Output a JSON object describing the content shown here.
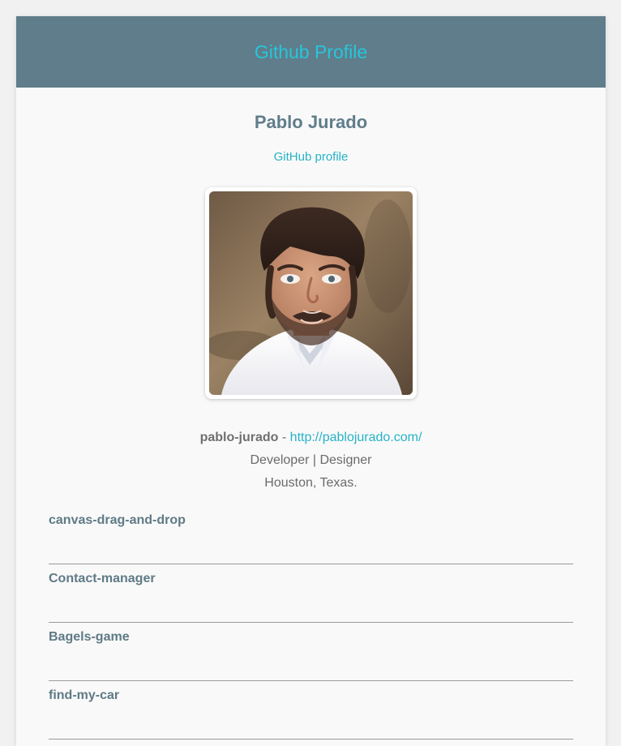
{
  "header": {
    "title": "Github Profile"
  },
  "profile": {
    "name": "Pablo Jurado",
    "profile_link_label": "GitHub profile",
    "login": "pablo-jurado",
    "separator": " - ",
    "website": "http://pablojurado.com/",
    "bio": "Developer | Designer",
    "location": "Houston, Texas."
  },
  "repos": [
    {
      "name": "canvas-drag-and-drop"
    },
    {
      "name": "Contact-manager"
    },
    {
      "name": "Bagels-game"
    },
    {
      "name": "find-my-car"
    }
  ],
  "colors": {
    "header_bg": "#607d8b",
    "accent": "#26c6da",
    "name_text": "#607d8b"
  }
}
